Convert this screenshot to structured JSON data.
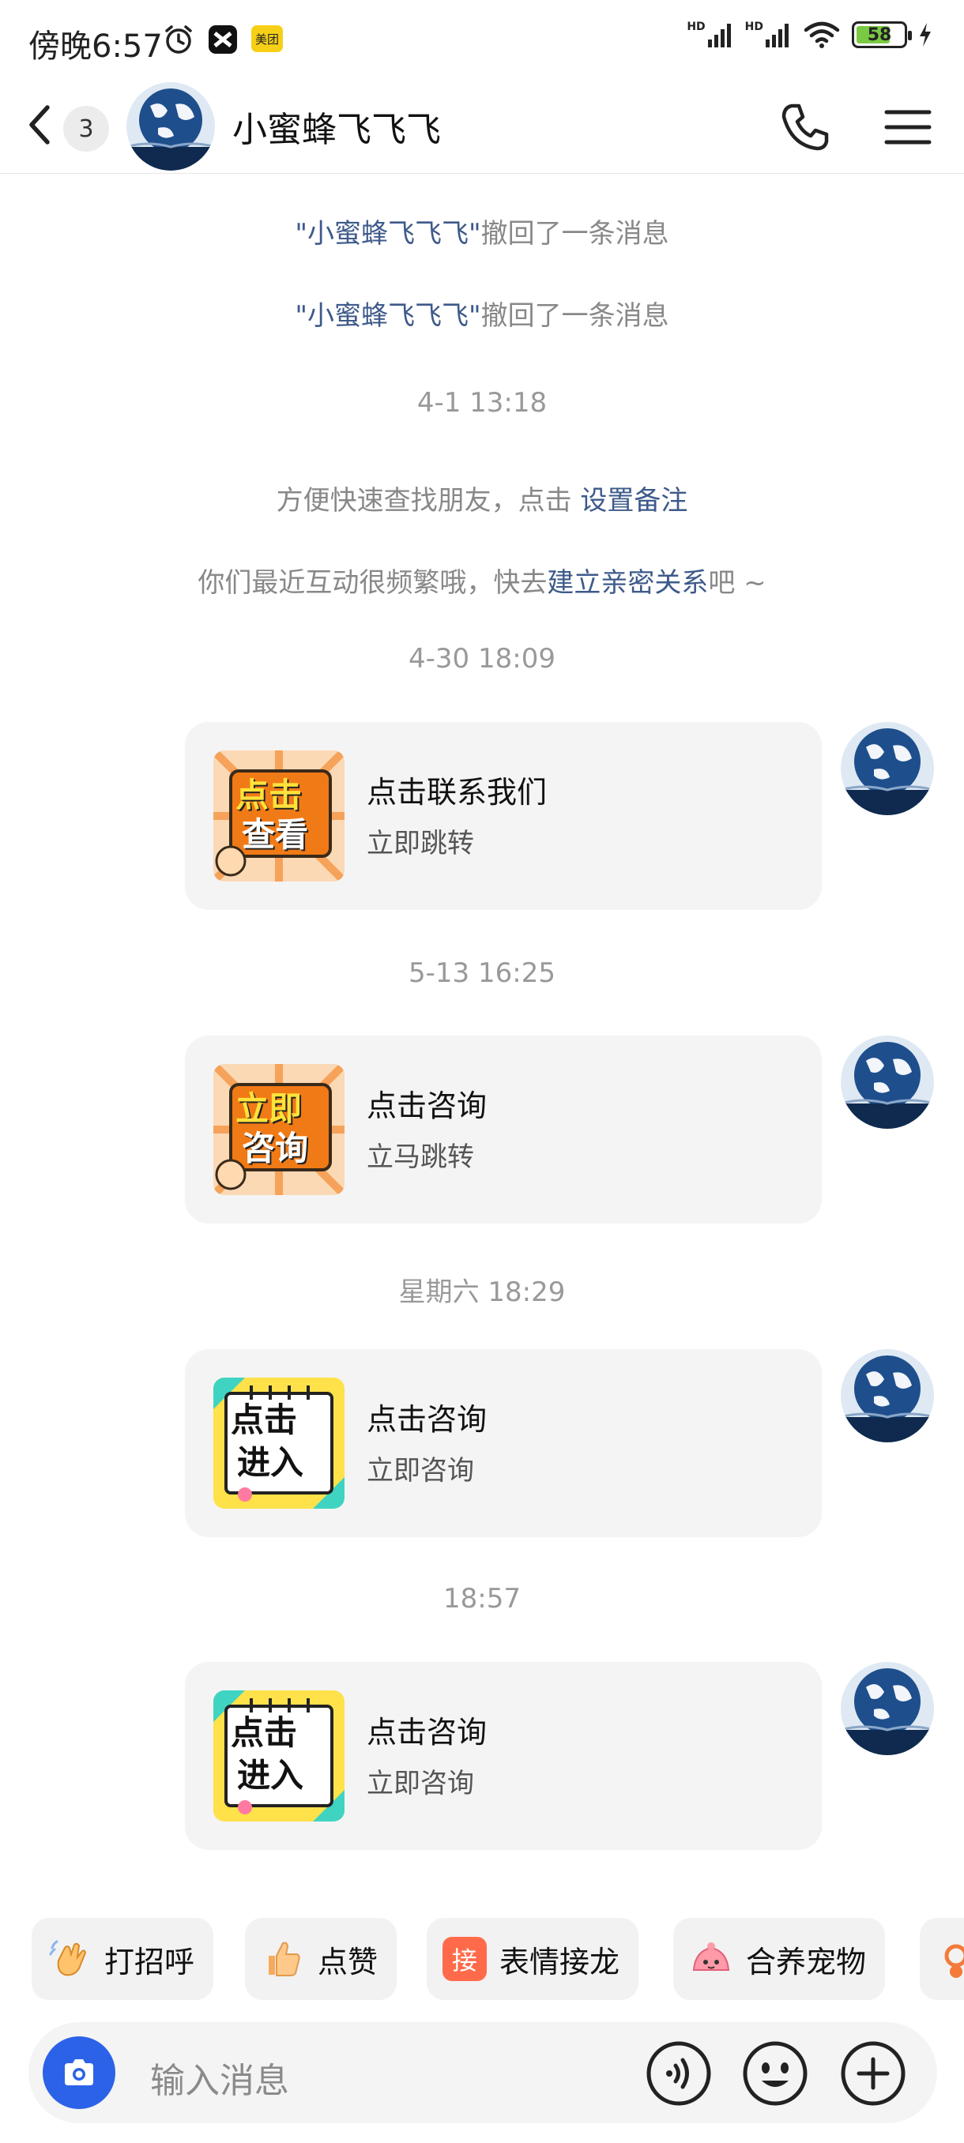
{
  "status_bar": {
    "time": "傍晚6:57",
    "meituan_label": "美团",
    "signal_label_1": "HD",
    "signal_label_2": "HD",
    "battery": "58",
    "colors": {
      "battery_fill": "#7ac943",
      "meituan": "#f6d017"
    }
  },
  "header": {
    "unread_count": "3",
    "title": "小蜜蜂飞飞飞",
    "icons": [
      "back-icon",
      "phone-icon",
      "menu-icon"
    ]
  },
  "messages": {
    "recall_1": {
      "name": "\"小蜜蜂飞飞飞\"",
      "text": "撤回了一条消息"
    },
    "recall_2": {
      "name": "\"小蜜蜂飞飞飞\"",
      "text": "撤回了一条消息"
    },
    "ts_1": "4-1 13:18",
    "hint_1": {
      "text": "方便快速查找朋友，点击 ",
      "link": "设置备注"
    },
    "hint_2": {
      "text": "你们最近互动很频繁哦，快去",
      "link": "建立亲密关系",
      "suffix": "吧 ~"
    },
    "ts_2": "4-30 18:09",
    "card_1": {
      "thumb_line1": "点击",
      "thumb_line2": "查看",
      "title": "点击联系我们",
      "subtitle": "立即跳转"
    },
    "ts_3": "5-13 16:25",
    "card_2": {
      "thumb_line1": "立即",
      "thumb_line2": "咨询",
      "title": "点击咨询",
      "subtitle": "立马跳转"
    },
    "ts_4": "星期六 18:29",
    "card_3": {
      "thumb_line1": "点击",
      "thumb_line2": "进入",
      "title": "点击咨询",
      "subtitle": "立即咨询"
    },
    "ts_5": "18:57",
    "card_4": {
      "thumb_line1": "点击",
      "thumb_line2": "进入",
      "title": "点击咨询",
      "subtitle": "立即咨询"
    }
  },
  "quick_replies": [
    {
      "label": "打招呼",
      "icon": "wave-hand-icon"
    },
    {
      "label": "点赞",
      "icon": "thumbs-up-icon"
    },
    {
      "label": "表情接龙",
      "icon": "emoji-chain-icon",
      "icon_text": "接"
    },
    {
      "label": "合养宠物",
      "icon": "pet-icon"
    }
  ],
  "input": {
    "placeholder": "输入消息",
    "icons": [
      "camera-icon",
      "voice-icon",
      "emoji-icon",
      "add-icon"
    ],
    "colors": {
      "camera_bg": "#2c62e8"
    }
  }
}
